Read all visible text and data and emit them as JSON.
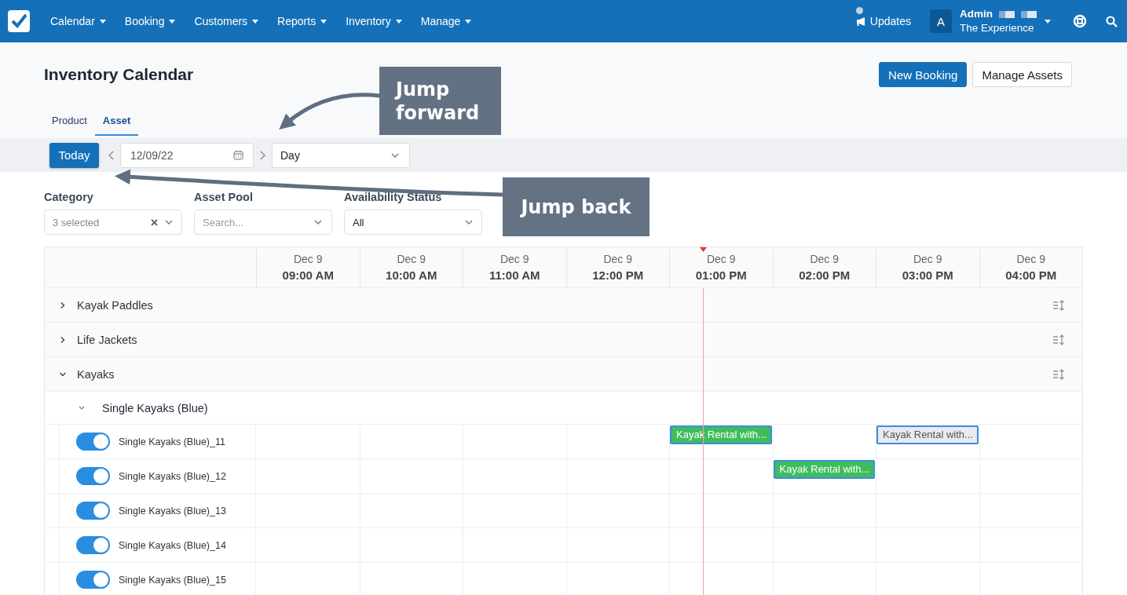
{
  "nav": {
    "menus": [
      {
        "label": "Calendar"
      },
      {
        "label": "Booking"
      },
      {
        "label": "Customers"
      },
      {
        "label": "Reports"
      },
      {
        "label": "Inventory"
      },
      {
        "label": "Manage"
      }
    ],
    "updates": {
      "label": "Updates",
      "unread": true
    },
    "account": {
      "initial": "A",
      "name": "Admin",
      "company": "The Experience"
    }
  },
  "page": {
    "title": "Inventory Calendar",
    "actions": [
      {
        "label": "New Booking",
        "kind": "primary"
      },
      {
        "label": "Manage Assets",
        "kind": "secondary"
      }
    ],
    "tabs": [
      {
        "label": "Product",
        "selected": false
      },
      {
        "label": "Asset",
        "selected": true
      }
    ]
  },
  "toolbar": {
    "today": "Today",
    "date": "12/09/22",
    "view": "Day"
  },
  "filters": [
    {
      "label": "Category",
      "value": "3 selected",
      "clearable": true
    },
    {
      "label": "Asset Pool",
      "placeholder": "Search..."
    },
    {
      "label": "Availability Status",
      "value": "All"
    }
  ],
  "calendar": {
    "columns": [
      {
        "date": "Dec 9",
        "time": "09:00 AM"
      },
      {
        "date": "Dec 9",
        "time": "10:00 AM"
      },
      {
        "date": "Dec 9",
        "time": "11:00 AM"
      },
      {
        "date": "Dec 9",
        "time": "12:00 PM"
      },
      {
        "date": "Dec 9",
        "time": "01:00 PM"
      },
      {
        "date": "Dec 9",
        "time": "02:00 PM"
      },
      {
        "date": "Dec 9",
        "time": "03:00 PM"
      },
      {
        "date": "Dec 9",
        "time": "04:00 PM"
      }
    ],
    "groups": [
      {
        "name": "Kayak Paddles",
        "expanded": false
      },
      {
        "name": "Life Jackets",
        "expanded": false
      },
      {
        "name": "Kayaks",
        "expanded": true,
        "children": [
          {
            "name": "Single Kayaks (Blue)",
            "expanded": true,
            "children": [
              {
                "name": "Single Kayaks (Blue)_11",
                "on": true,
                "cells": [
                  null,
                  null,
                  null,
                  null,
                  {
                    "label": "Kayak Rental with...",
                    "kind": "booked"
                  },
                  null,
                  {
                    "label": "Kayak Rental with...",
                    "kind": "hold"
                  },
                  null
                ]
              },
              {
                "name": "Single Kayaks (Blue)_12",
                "on": true,
                "cells": [
                  null,
                  null,
                  null,
                  null,
                  null,
                  {
                    "label": "Kayak Rental with...",
                    "kind": "booked"
                  },
                  null,
                  null
                ]
              },
              {
                "name": "Single Kayaks (Blue)_13",
                "on": true,
                "cells": [
                  null,
                  null,
                  null,
                  null,
                  null,
                  null,
                  null,
                  null
                ]
              },
              {
                "name": "Single Kayaks (Blue)_14",
                "on": true,
                "cells": [
                  null,
                  null,
                  null,
                  null,
                  null,
                  null,
                  null,
                  null
                ]
              },
              {
                "name": "Single Kayaks (Blue)_15",
                "on": true,
                "cells": [
                  null,
                  null,
                  null,
                  null,
                  null,
                  null,
                  null,
                  null
                ]
              }
            ]
          }
        ]
      }
    ]
  },
  "annotations": [
    {
      "text": "Jump forward",
      "kind": "forward"
    },
    {
      "text": "Jump back",
      "kind": "back"
    }
  ]
}
